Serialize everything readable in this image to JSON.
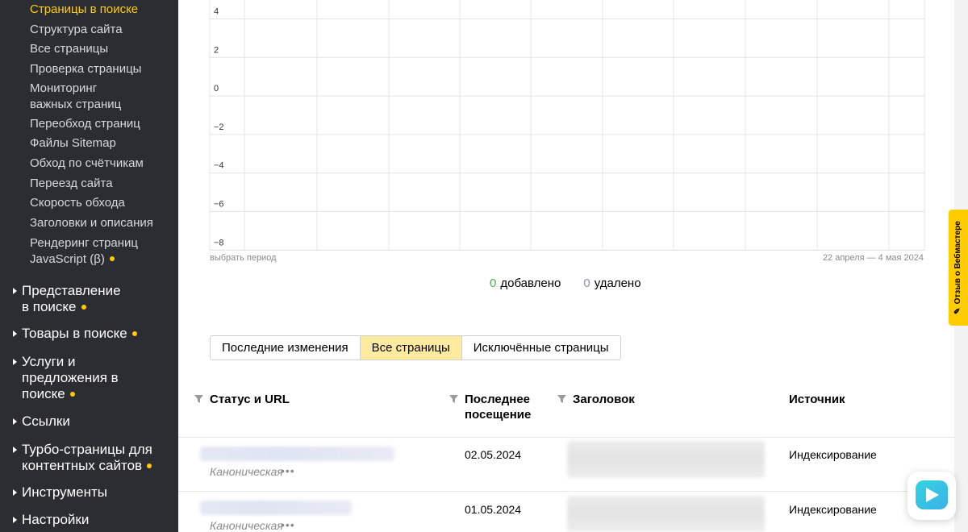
{
  "sidebar": {
    "sub_items": [
      {
        "label": "Страницы в поиске"
      },
      {
        "label": "Структура сайта"
      },
      {
        "label": "Все страницы"
      },
      {
        "label": "Проверка страницы"
      },
      {
        "label_line1": "Мониторинг",
        "label_line2": "важных страниц"
      },
      {
        "label": "Переобход страниц"
      },
      {
        "label": "Файлы Sitemap"
      },
      {
        "label": "Обход по счётчикам"
      },
      {
        "label": "Переезд сайта"
      },
      {
        "label": "Скорость обхода"
      },
      {
        "label": "Заголовки и описания"
      },
      {
        "label_line1": "Рендеринг страниц",
        "label_line2": "JavaScript (β)"
      }
    ],
    "sections": [
      {
        "line1": "Представление",
        "line2": "в поиске"
      },
      {
        "line1": "Товары в поиске"
      },
      {
        "line1": "Услуги и",
        "line2": "предложения в",
        "line3": "поиске"
      },
      {
        "line1": "Ссылки"
      },
      {
        "line1": "Турбо-страницы для",
        "line2": "контентных сайтов"
      },
      {
        "line1": "Инструменты"
      },
      {
        "line1": "Настройки"
      }
    ]
  },
  "chart": {
    "period_link": "выбрать период",
    "range": "22 апреля — 4 мая 2024"
  },
  "chart_data": {
    "type": "line",
    "title": "",
    "xlabel": "",
    "ylabel": "",
    "y_ticks": [
      "4",
      "2",
      "0",
      "−2",
      "−4",
      "−6",
      "−8"
    ],
    "ylim": [
      -8,
      4
    ],
    "grid": true,
    "series": []
  },
  "counts": {
    "added_value": "0",
    "added_label": "добавлено",
    "removed_value": "0",
    "removed_label": "удалено",
    "added_color": "#4caf50",
    "removed_color": "#8f95a3"
  },
  "tabs": [
    {
      "label": "Последние изменения"
    },
    {
      "label": "Все страницы"
    },
    {
      "label": "Исключённые страницы"
    }
  ],
  "table": {
    "headers": {
      "status_url": "Статус и URL",
      "last_visit_line1": "Последнее",
      "last_visit_line2": "посещение",
      "title": "Заголовок",
      "source": "Источник"
    },
    "rows": [
      {
        "status": "Каноническая",
        "date": "02.05.2024",
        "source": "Индексирование"
      },
      {
        "status": "Каноническая",
        "date": "01.05.2024",
        "source": "Индексирование"
      }
    ]
  },
  "feedback": {
    "label": "Отзыв о Вебмастере"
  },
  "colors": {
    "sidebar_bg": "#2b2d33",
    "accent": "#ffcc00",
    "active_tab": "#ffeba0"
  }
}
